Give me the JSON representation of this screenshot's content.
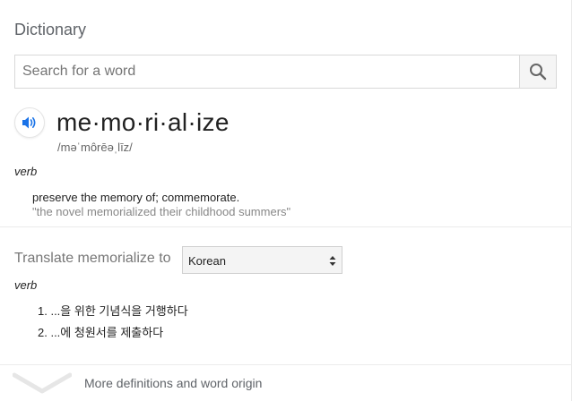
{
  "dictionary": {
    "title": "Dictionary"
  },
  "search": {
    "placeholder": "Search for a word",
    "value": ""
  },
  "entry": {
    "headword": "me·mo·ri·al·ize",
    "phonetic": "/məˈmôrēəˌlīz/",
    "senses": [
      {
        "part_of_speech": "verb",
        "definition": "preserve the memory of; commemorate.",
        "example": "\"the novel memorialized their childhood summers\""
      }
    ]
  },
  "translate": {
    "label": "Translate memorialize to",
    "selected_language": "Korean",
    "part_of_speech": "verb",
    "items": [
      "1.  ...을 위한 기념식을 거행하다",
      "2.  ...에 청원서를 제출하다"
    ]
  },
  "footer": {
    "more_label": "More definitions and word origin"
  },
  "colors": {
    "accent": "#1a73e8",
    "title_gray": "#5f6368",
    "example_gray": "#878787"
  },
  "icons": {
    "search": "search-icon",
    "audio": "speaker-icon",
    "select": "select-arrows-icon",
    "expand": "chevron-down-icon"
  }
}
